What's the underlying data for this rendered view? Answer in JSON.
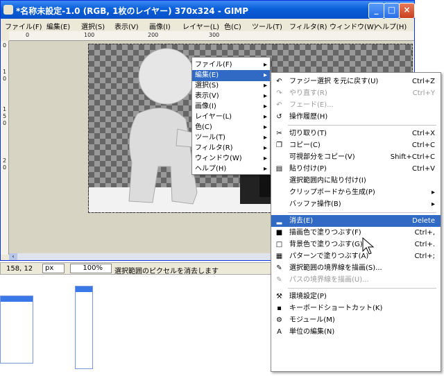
{
  "window": {
    "title": "*名称未設定-1.0 (RGB, 1枚のレイヤー) 370x324 - GIMP",
    "controls": {
      "minimize": "_",
      "maximize": "□",
      "close": "×"
    }
  },
  "menubar": [
    "ファイル(F)",
    "編集(E)",
    "選択(S)",
    "表示(V)",
    "画像(I)",
    "レイヤー(L)",
    "色(C)",
    "ツール(T)",
    "フィルタ(R)",
    "ウィンドウ(W)",
    "ヘルプ(H)"
  ],
  "ruler": {
    "h_ticks": [
      "0",
      "100",
      "200",
      "300"
    ],
    "v_ticks": [
      "0",
      "1",
      "0",
      "1",
      "5",
      "0",
      "2",
      "0"
    ]
  },
  "status": {
    "coords": "158, 12",
    "unit": "px",
    "zoom": "100%",
    "message": "選択範囲のピクセルを消去します"
  },
  "image_menu": {
    "items": [
      {
        "label": "ファイル(F)",
        "arrow": "▸"
      },
      {
        "label": "編集(E)",
        "arrow": "▸",
        "selected": true
      },
      {
        "label": "選択(S)",
        "arrow": "▸"
      },
      {
        "label": "表示(V)",
        "arrow": "▸"
      },
      {
        "label": "画像(I)",
        "arrow": "▸"
      },
      {
        "label": "レイヤー(L)",
        "arrow": "▸"
      },
      {
        "label": "色(C)",
        "arrow": "▸"
      },
      {
        "label": "ツール(T)",
        "arrow": "▸"
      },
      {
        "label": "フィルタ(R)",
        "arrow": "▸"
      },
      {
        "label": "ウィンドウ(W)",
        "arrow": "▸"
      },
      {
        "label": "ヘルプ(H)",
        "arrow": "▸"
      }
    ]
  },
  "edit_menu": {
    "items": [
      {
        "label": "ファジー選択 を元に戻す(U)",
        "shortcut": "Ctrl+Z",
        "icon": "undo-icon",
        "glyph": "↶"
      },
      {
        "label": "やり直す(R)",
        "shortcut": "Ctrl+Y",
        "icon": "redo-icon",
        "glyph": "↷",
        "disabled": true
      },
      {
        "label": "フェード(E)...",
        "shortcut": "",
        "icon": "fade-icon",
        "glyph": "↶",
        "disabled": true
      },
      {
        "label": "操作履歴(H)",
        "shortcut": "",
        "icon": "history-icon",
        "glyph": "↺",
        "sep_after": true
      },
      {
        "label": "切り取り(T)",
        "shortcut": "Ctrl+X",
        "icon": "scissors-icon",
        "glyph": "✂"
      },
      {
        "label": "コピー(C)",
        "shortcut": "Ctrl+C",
        "icon": "copy-icon",
        "glyph": "❐"
      },
      {
        "label": "可視部分をコピー(V)",
        "shortcut": "Shift+Ctrl+C",
        "icon": "",
        "glyph": ""
      },
      {
        "label": "貼り付け(P)",
        "shortcut": "Ctrl+V",
        "icon": "paste-icon",
        "glyph": "▤"
      },
      {
        "label": "選択範囲内に貼り付け(I)",
        "shortcut": "",
        "icon": "",
        "glyph": ""
      },
      {
        "label": "クリップボードから生成(P)",
        "shortcut": "",
        "arrow": "▸",
        "icon": "",
        "glyph": ""
      },
      {
        "label": "バッファ操作(B)",
        "shortcut": "",
        "arrow": "▸",
        "icon": "",
        "glyph": "",
        "sep_after": true
      },
      {
        "label": "消去(E)",
        "shortcut": "Delete",
        "icon": "clear-icon",
        "glyph": "▂",
        "selected": true
      },
      {
        "label": "描画色で塗りつぶす(F)",
        "shortcut": "Ctrl+,",
        "icon": "fg-color-icon",
        "glyph": "■"
      },
      {
        "label": "背景色で塗りつぶす(G)",
        "shortcut": "Ctrl+.",
        "icon": "bg-color-icon",
        "glyph": "□"
      },
      {
        "label": "パターンで塗りつぶす(A)",
        "shortcut": "Ctrl+;",
        "icon": "pattern-icon",
        "glyph": "▦"
      },
      {
        "label": "選択範囲の境界線を描画(S)...",
        "shortcut": "",
        "icon": "stroke-selection-icon",
        "glyph": "✎"
      },
      {
        "label": "パスの境界線を描画(U)...",
        "shortcut": "",
        "icon": "stroke-path-icon",
        "glyph": "✎",
        "disabled": true,
        "sep_after": true
      },
      {
        "label": "環境設定(P)",
        "shortcut": "",
        "icon": "preferences-icon",
        "glyph": "⚒"
      },
      {
        "label": "キーボードショートカット(K)",
        "shortcut": "",
        "icon": "keyboard-icon",
        "glyph": "▪"
      },
      {
        "label": "モジュール(M)",
        "shortcut": "",
        "icon": "module-icon",
        "glyph": "⚙"
      },
      {
        "label": "単位の編集(N)",
        "shortcut": "",
        "icon": "units-icon",
        "glyph": "A"
      }
    ]
  },
  "colors": {
    "title_bar": "#0a5fd8",
    "highlight": "#316ac5",
    "menu_bg": "#ffffff"
  }
}
